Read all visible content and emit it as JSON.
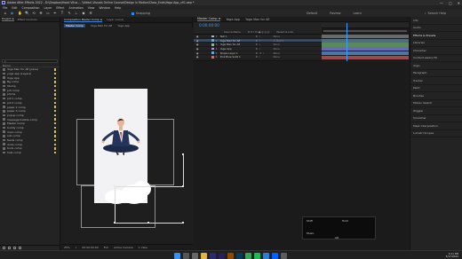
{
  "window": {
    "title": "Adobe After Effects 2022 - D:\\Dropbox\\Head Vitus ... \\Video\\ Visuals Online Course\\Design in Motion\\Class_Ends\\Yoga App_v01.aep *",
    "controls": [
      "—",
      "□",
      "✕"
    ]
  },
  "menu": [
    "File",
    "Edit",
    "Composition",
    "Layer",
    "Effect",
    "Animation",
    "View",
    "Window",
    "Help"
  ],
  "toolbar": {
    "tools": [
      "⌂",
      "▶",
      "✋",
      "🔍",
      "⟲",
      "✥",
      "▭",
      "✒",
      "T",
      "✎",
      "⊥",
      "◆",
      "✲"
    ],
    "snapping_label": "Snapping",
    "right_tools": [
      "Default",
      "Review",
      "Learn"
    ],
    "search_label": "Search Help"
  },
  "project": {
    "tabs": [
      "Project ≡",
      "Effect Controls"
    ],
    "search_placeholder": "ρ",
    "column_header": "Name",
    "items": [
      "Yoga Man for AE (pane)",
      "yoga app (Layers)",
      "Yoga App",
      "Bg comp",
      "Stomp",
      "pill comp",
      "phone",
      "pill 1 comp",
      "pill 2 comp",
      "paper 2 comp",
      "paper 3 comp",
      "popup comp",
      "message bubble comp",
      "Master Comp",
      "buddy comp",
      "main comp",
      "sub comp",
      "feeds comp",
      "dude comp",
      "tools comp",
      "hats comp"
    ],
    "label_color": "#d4c24a"
  },
  "composition": {
    "tabs": [
      "Composition Master Comp ≡",
      "Layer (none)"
    ],
    "sub_tabs": [
      "Master Comp",
      "Yoga Man for AE",
      "Yoga App"
    ],
    "footer": [
      "25%",
      "⌖",
      "00:00:00:00",
      "Full",
      "Active Camera",
      "1 View"
    ]
  },
  "timeline": {
    "tabs": [
      "Master Comp ≡",
      "Yoga App",
      "Yoga Man for AE"
    ],
    "timecode": "0:00:00:00",
    "columns": [
      "Source Name",
      "♦ ✲ \\ fx ▣ ◎ ◎ ◎",
      "Parent & Link"
    ],
    "layers": [
      {
        "num": "1",
        "name": "Null 1",
        "switches": "♦ /",
        "parent": "None",
        "color": "#b0b0b0",
        "bar": "#6a6a6a"
      },
      {
        "num": "2",
        "name": "Yoga Man for AE",
        "switches": "♦ /",
        "parent": "1. Null 1",
        "color": "#7aa8c9",
        "bar": "#4e6d82"
      },
      {
        "num": "3",
        "name": "Yoga Man for AE",
        "switches": "♦ /",
        "parent": "None",
        "color": "#7fbf7f",
        "bar": "#5a8a5a"
      },
      {
        "num": "4",
        "name": "Yoga App",
        "switches": "♦ /",
        "parent": "None",
        "color": "#c18ad1",
        "bar": "#6b6ab0"
      },
      {
        "num": "5",
        "name": "Shape Layer 1",
        "switches": "♦ ✲ /",
        "parent": "None",
        "color": "#6fa3d6",
        "bar": "#4d76a6"
      },
      {
        "num": "6",
        "name": "Pink Blue Solid 1",
        "switches": "♦ /",
        "parent": "None",
        "color": "#d46a6a",
        "bar": "#9a4b4b"
      }
    ],
    "footer_label": "Frame Render Time: 0ms"
  },
  "right_panel": {
    "items": [
      "Info",
      "Audio",
      "Effects & Presets",
      "Libraries",
      "Character",
      "Content-Aware Fill",
      "Align",
      "Paragraph",
      "Tracker",
      "Paint",
      "Brushes",
      "Motion Sketch",
      "Wiggler",
      "Smoother",
      "Mask Interpolation",
      "Lumetri Scopes"
    ]
  },
  "popup": {
    "labels": [
      "Shift",
      "Hold",
      "Music",
      "Alt",
      "Gift",
      "Notes",
      "Drop"
    ]
  },
  "taskbar": {
    "icons": [
      {
        "name": "windows",
        "color": "#3b8eea"
      },
      {
        "name": "search",
        "color": "#555555"
      },
      {
        "name": "task-view",
        "color": "#666666"
      },
      {
        "name": "file-explorer",
        "color": "#e3b341"
      },
      {
        "name": "after-effects",
        "color": "#2c2a6e"
      },
      {
        "name": "premiere",
        "color": "#2a1f5e"
      },
      {
        "name": "illustrator",
        "color": "#8a4b00"
      },
      {
        "name": "photoshop",
        "color": "#0a3a5e"
      },
      {
        "name": "chrome",
        "color": "#3aa35a"
      },
      {
        "name": "spotify",
        "color": "#1db954"
      },
      {
        "name": "mail",
        "color": "#2d7dd2"
      },
      {
        "name": "dropbox",
        "color": "#0061fe"
      },
      {
        "name": "app",
        "color": "#5c5c5c"
      }
    ],
    "time": "4:11 PM",
    "date": "5/17/2022",
    "temp": "55°F"
  }
}
